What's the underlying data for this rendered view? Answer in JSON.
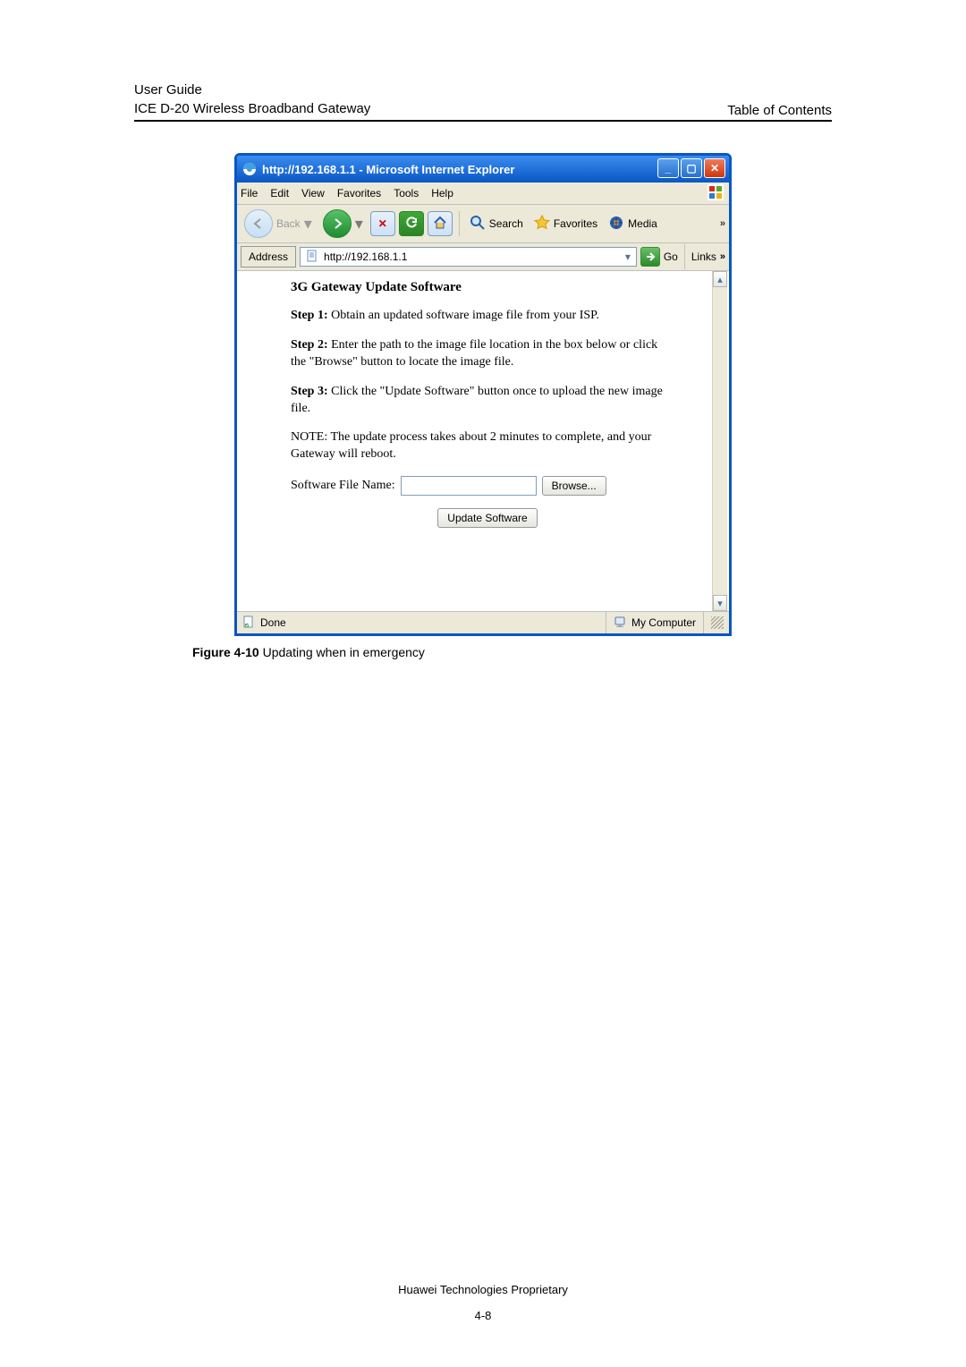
{
  "header": {
    "line1": "User Guide",
    "line2": "ICE D-20 Wireless Broadband Gateway",
    "right": "Table of Contents"
  },
  "ie_window": {
    "title": "http://192.168.1.1 - Microsoft Internet Explorer",
    "menubar": [
      "File",
      "Edit",
      "View",
      "Favorites",
      "Tools",
      "Help"
    ],
    "toolbar": {
      "back": "Back",
      "search": "Search",
      "favorites": "Favorites",
      "media": "Media"
    },
    "addressbar": {
      "label": "Address",
      "url": "http://192.168.1.1",
      "go": "Go",
      "links": "Links"
    },
    "content": {
      "heading": "3G Gateway Update Software",
      "step1_label": "Step 1:",
      "step1_text": " Obtain an updated software image file from your ISP.",
      "step2_label": "Step 2:",
      "step2_text": " Enter the path to the image file location in the box below or click the \"Browse\" button to locate the image file.",
      "step3_label": "Step 3:",
      "step3_text": " Click the \"Update Software\" button once to upload the new image file.",
      "note": "NOTE: The update process takes about 2 minutes to complete, and your Gateway will reboot.",
      "file_label": "Software File Name:",
      "browse_btn": "Browse...",
      "update_btn": "Update Software"
    },
    "statusbar": {
      "done": "Done",
      "zone": "My Computer"
    }
  },
  "figure_caption": {
    "label": "Figure 4-10 ",
    "text": "Updating when in emergency"
  },
  "footer": {
    "proprietary": "Huawei Technologies Proprietary",
    "page": "4-8"
  }
}
